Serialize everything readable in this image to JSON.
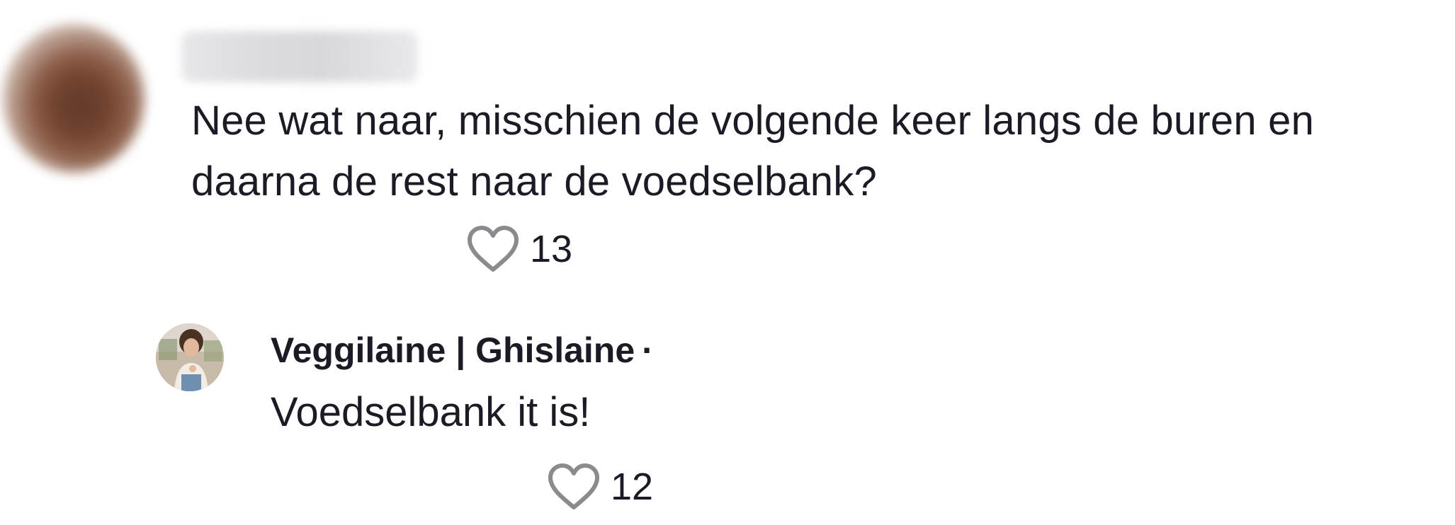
{
  "comment": {
    "text_line1": "Nee wat naar, misschien de volgende keer langs de buren en",
    "text_line2": "daarna de rest naar de voedselbank?",
    "likes": "13"
  },
  "reply": {
    "author": "Veggilaine | Ghislaine",
    "separator": "·",
    "text": "Voedselbank it is!",
    "likes": "12"
  },
  "icons": {
    "like": "heart-outline-icon"
  },
  "colors": {
    "text": "#1b1b26",
    "icon_stroke": "#8a8a8f",
    "background": "#ffffff"
  }
}
